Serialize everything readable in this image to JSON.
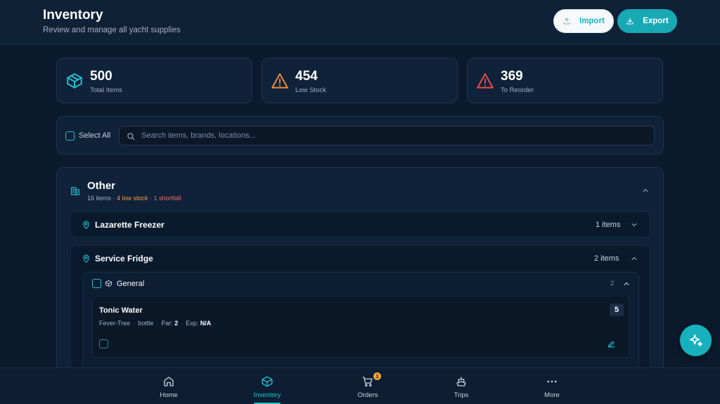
{
  "header": {
    "title": "Inventory",
    "subtitle": "Review and manage all yacht supplies",
    "import_label": "Import",
    "export_label": "Export"
  },
  "stats": [
    {
      "value": "500",
      "label": "Total Items",
      "icon": "box-icon",
      "color": "#22c3d0"
    },
    {
      "value": "454",
      "label": "Low Stock",
      "icon": "warning-icon",
      "color": "#f08a3c"
    },
    {
      "value": "369",
      "label": "To Reorder",
      "icon": "alert-icon",
      "color": "#ef4b4b"
    }
  ],
  "toolbar": {
    "select_all_label": "Select All",
    "search_placeholder": "Search items, brands, locations..."
  },
  "group": {
    "title": "Other",
    "items_count": "16 items",
    "separator": " · ",
    "low_stock": "4 low stock",
    "shortfall": "1 shortfall"
  },
  "locations": [
    {
      "name": "Lazarette Freezer",
      "count": "1 items"
    },
    {
      "name": "Service Fridge",
      "count": "2 items"
    }
  ],
  "category": {
    "name": "General",
    "count": "2"
  },
  "item": {
    "name": "Tonic Water",
    "brand": "Fever-Tree",
    "unit": "bottle",
    "par_label": "Par:",
    "par_value": "2",
    "exp_label": "Exp:",
    "exp_value": "N/A",
    "qty": "5"
  },
  "nav": [
    {
      "label": "Home",
      "icon": "home-icon"
    },
    {
      "label": "Inventory",
      "icon": "box-icon",
      "active": true
    },
    {
      "label": "Orders",
      "icon": "cart-icon",
      "badge": "1"
    },
    {
      "label": "Trips",
      "icon": "boat-icon"
    },
    {
      "label": "More",
      "icon": "more-icon"
    }
  ],
  "colors": {
    "accent": "#18a9b5",
    "background": "#0b1a2c",
    "warning": "#f29a4a",
    "danger": "#f06a6a"
  }
}
